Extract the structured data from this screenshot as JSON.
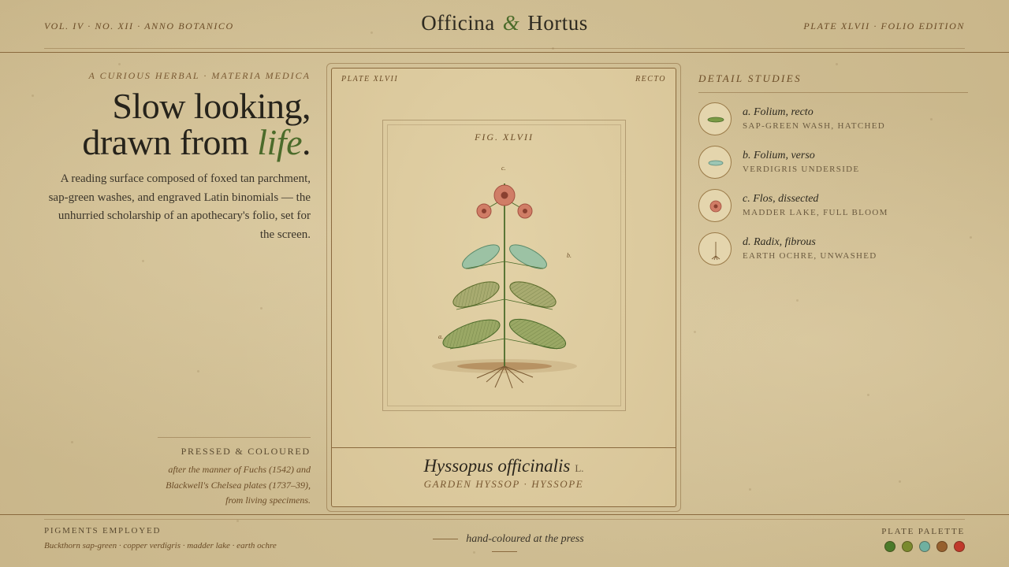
{
  "header": {
    "left": "VOL. IV · NO. XII · ANNO BOTANICO",
    "brand_first": "Officina",
    "brand_amp": "&",
    "brand_second": "Hortus",
    "right": "PLATE XLVII · FOLIO EDITION"
  },
  "intro": {
    "kicker": "A CURIOUS HERBAL · MATERIA MEDICA",
    "headline_line1": "Slow looking,",
    "headline_line2_a": "drawn from ",
    "headline_accent": "life",
    "headline_end": ".",
    "lede": "A reading surface composed of foxed tan parchment, sap-green washes, and engraved Latin binomials — the unhurried scholarship of an apothecary's folio, set for the screen."
  },
  "pressed": {
    "title": "PRESSED & COLOURED",
    "note": "after the manner of Fuchs (1542) and Blackwell's Chelsea plates (1737–39), from living specimens."
  },
  "plate": {
    "corner_left": "PLATE XLVII",
    "corner_right": "RECTO",
    "fig": "FIG. XLVII",
    "marker_a": "a.",
    "marker_b": "b.",
    "marker_c": "c.",
    "species": "Hyssopus officinalis",
    "authority": "L.",
    "common": "GARDEN HYSSOP · HYSSOPE"
  },
  "details": {
    "title": "DETAIL STUDIES",
    "items": [
      {
        "name": "a. Folium, recto",
        "sub": "SAP-GREEN WASH, HATCHED",
        "icon": "leaf-recto-icon"
      },
      {
        "name": "b. Folium, verso",
        "sub": "VERDIGRIS UNDERSIDE",
        "icon": "leaf-verso-icon"
      },
      {
        "name": "c. Flos, dissected",
        "sub": "MADDER LAKE, FULL BLOOM",
        "icon": "flower-icon"
      },
      {
        "name": "d. Radix, fibrous",
        "sub": "EARTH OCHRE, UNWASHED",
        "icon": "root-icon"
      }
    ]
  },
  "footer": {
    "pigments_title": "PIGMENTS EMPLOYED",
    "pigments_list": "Buckthorn sap-green · copper verdigris · madder lake · earth ochre",
    "press": "hand-coloured at the press",
    "palette_title": "PLATE PALETTE",
    "palette": [
      "#4b7a2a",
      "#7a8a2e",
      "#6fb0a0",
      "#96602e",
      "#c0392b"
    ]
  }
}
